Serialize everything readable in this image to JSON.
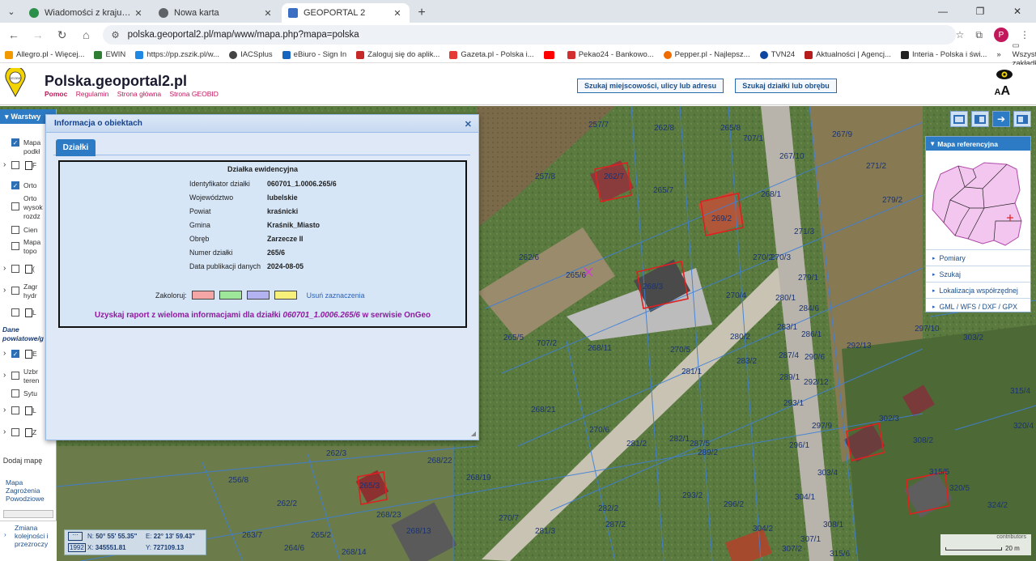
{
  "browser": {
    "tabs": [
      {
        "title": "Wiadomości z kraju i ze świata"
      },
      {
        "title": "Nowa karta"
      },
      {
        "title": "GEOPORTAL 2"
      }
    ],
    "url": "polska.geoportal2.pl/map/www/mapa.php?mapa=polska",
    "profile_initial": "P",
    "bookmarks": [
      "Allegro.pl - Więcej...",
      "EWIN",
      "https://pp.zszik.pl/w...",
      "IACSplus",
      "eBiuro - Sign In",
      "Zaloguj się do aplik...",
      "Gazeta.pl - Polska i...",
      "",
      "Pekao24 - Bankowo...",
      "Pepper.pl - Najlepsz...",
      "TVN24",
      "Aktualności | Agencj...",
      "Interia - Polska i świ..."
    ],
    "all_bookmarks": "Wszystkie zakładki",
    "bookmark_more": "»"
  },
  "header": {
    "logo_text": "GEOBID",
    "title": "Polska.geoportal2.pl",
    "links": [
      "Pomoc",
      "Regulamin",
      "Strona główna",
      "Strona GEOBID"
    ],
    "search_address": "Szukaj miejscowości, ulicy lub adresu",
    "search_parcel": "Szukaj działki lub obrębu",
    "font_size_label": "AA"
  },
  "layers": {
    "title": "Warstwy",
    "items": [
      {
        "label": "Mapa podkł",
        "checked": true
      },
      {
        "label": "F",
        "checked": false
      },
      {
        "label": "Orto",
        "checked": true
      },
      {
        "label": "Orto wysok rozdz",
        "checked": false
      },
      {
        "label": "Cien",
        "checked": false
      },
      {
        "label": "Mapa topo",
        "checked": false
      },
      {
        "label": "(",
        "checked": false
      },
      {
        "label": "Zagr hydr",
        "checked": false
      },
      {
        "label": "L",
        "checked": false
      }
    ],
    "group_label": "Dane powiatowe/g",
    "items2": [
      {
        "label": "E",
        "checked": true
      },
      {
        "label": "Uzbr teren",
        "checked": false
      },
      {
        "label": "Sytu",
        "checked": false
      },
      {
        "label": "L",
        "checked": false
      },
      {
        "label": "Z",
        "checked": false
      }
    ],
    "add_map": "Dodaj mapę",
    "flood_map": "Mapa Zagrożenia Powodziowe",
    "change_order": "Zmiana kolejności i przezroczy"
  },
  "panel": {
    "title": "Informacja o obiektach",
    "tab": "Działki",
    "box_title": "Działka ewidencyjna",
    "fields": [
      {
        "k": "Identyfikator działki",
        "v": "060701_1.0006.265/6"
      },
      {
        "k": "Województwo",
        "v": "lubelskie"
      },
      {
        "k": "Powiat",
        "v": "kraśnicki"
      },
      {
        "k": "Gmina",
        "v": "Kraśnik_Miasto"
      },
      {
        "k": "Obręb",
        "v": "Zarzecze II"
      },
      {
        "k": "Numer działki",
        "v": "265/6"
      },
      {
        "k": "Data publikacji danych",
        "v": "2024-08-05"
      }
    ],
    "color_label": "Zakoloruj:",
    "swatches": [
      "#f4a6a6",
      "#9ee69a",
      "#b3b3f2",
      "#f7f07a"
    ],
    "clear_label": "Usuń zaznaczenia",
    "report_prefix": "Uzyskaj raport z wieloma informacjami dla działki ",
    "report_id": "060701_1.0006.265/6",
    "report_suffix": " w serwisie OnGeo"
  },
  "refmap": {
    "title": "Mapa referencyjna",
    "menu": [
      "Pomiary",
      "Szukaj",
      "Lokalizacja współrzędnej",
      "GML / WFS / DXF / GPX"
    ]
  },
  "coords": {
    "n_label": "N:",
    "n": "50° 55' 55.35\"",
    "e_label": "E:",
    "e": "22° 13' 59.43\"",
    "sys": "1992",
    "x_label": "X:",
    "x": "345551.81",
    "y_label": "Y:",
    "y": "727109.13"
  },
  "scale": {
    "label": "20 m",
    "contributors": "contributors"
  },
  "map_labels": [
    "257/7",
    "262/8",
    "265/8",
    "267/9",
    "707/1",
    "267/10",
    "271/2",
    "257/8",
    "262/7",
    "265/7",
    "268/1",
    "279/2",
    "269/2",
    "271/3",
    "262/6",
    "265/6",
    "268/3",
    "270/2",
    "270/3",
    "279/1",
    "270/4",
    "280/1",
    "284/6",
    "265/5",
    "707/2",
    "268/11",
    "270/5",
    "280/2",
    "283/1",
    "286/1",
    "297/10",
    "303/2",
    "283/2",
    "287/4",
    "290/6",
    "292/13",
    "281/1",
    "289/1",
    "292/12",
    "315/4",
    "268/21",
    "270/6",
    "293/1",
    "297/9",
    "302/3",
    "281/2",
    "282/1",
    "287/5",
    "289/2",
    "296/1",
    "308/2",
    "320/4",
    "262/3",
    "268/22",
    "303/4",
    "315/5",
    "256/8",
    "265/3",
    "268/19",
    "293/2",
    "296/2",
    "304/1",
    "320/5",
    "262/2",
    "268/23",
    "270/7",
    "282/2",
    "287/2",
    "304/2",
    "308/1",
    "324/2",
    "263/7",
    "264/6",
    "265/2",
    "268/14",
    "268/13",
    "281/3",
    "307/1",
    "307/2",
    "315/6"
  ]
}
